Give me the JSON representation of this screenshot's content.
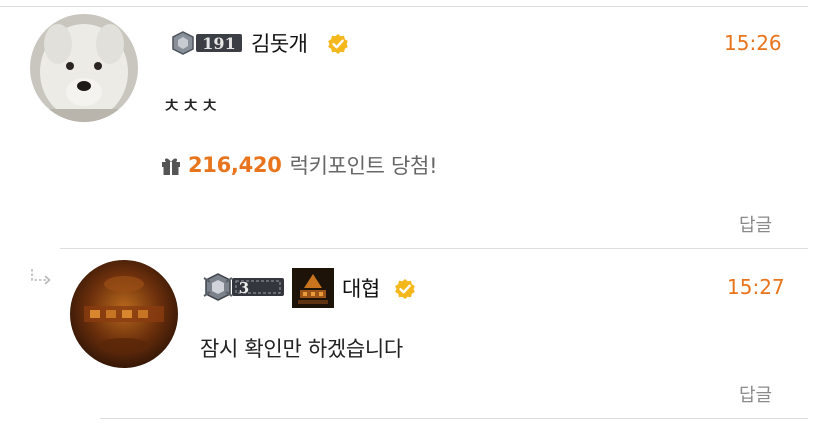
{
  "comments": [
    {
      "level": "191",
      "username": "김돗개",
      "time": "15:26",
      "message": "ㅊㅊㅊ",
      "lucky": {
        "points": "216,420",
        "text": "럭키포인트 당첨!"
      },
      "reply_label": "답글"
    },
    {
      "level": "3",
      "username": "대협",
      "time": "15:27",
      "message": "잠시 확인만 하겠습니다",
      "reply_label": "답글"
    }
  ],
  "colors": {
    "accent": "#e8741d",
    "verified": "#f5b81c",
    "muted": "#8a8a8a"
  },
  "icons": {
    "gift": "gift-icon",
    "verified": "verified-check-icon",
    "reply_arrow": "reply-arrow-icon"
  }
}
